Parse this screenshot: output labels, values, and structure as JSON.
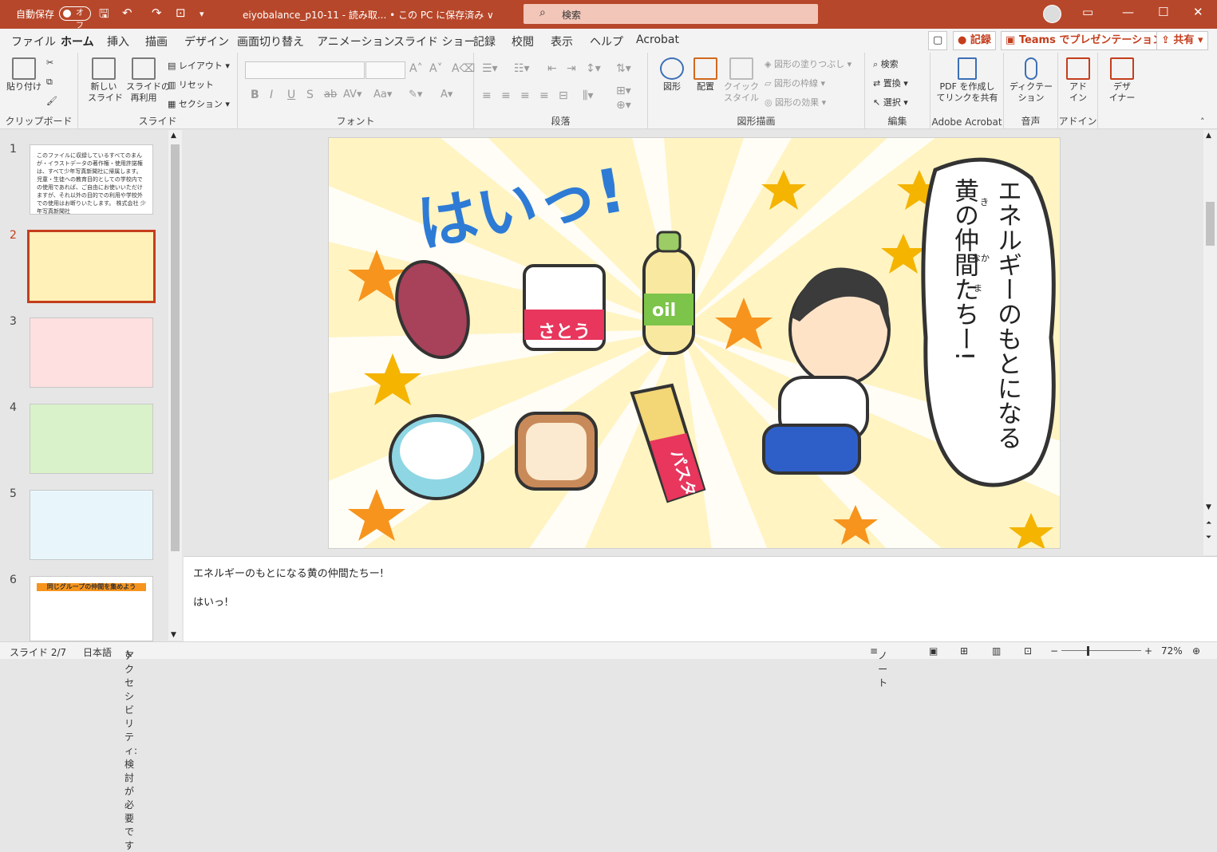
{
  "titlebar": {
    "autosave_label": "自動保存",
    "autosave_state": "オフ",
    "doc_title": "eiyobalance_p10-11 - 読み取... • この PC に保存済み ∨",
    "search_placeholder": "検索"
  },
  "tabs": [
    "ファイル",
    "ホーム",
    "挿入",
    "描画",
    "デザイン",
    "画面切り替え",
    "アニメーション",
    "スライド ショー",
    "記録",
    "校閲",
    "表示",
    "ヘルプ",
    "Acrobat"
  ],
  "tab_buttons": {
    "record": "記録",
    "teams": "Teams でプレゼンテーション",
    "share": "共有"
  },
  "ribbon": {
    "clipboard": {
      "paste": "貼り付け",
      "label": "クリップボード"
    },
    "slides": {
      "new_slide": "新しい\nスライド",
      "reuse": "スライドの\n再利用",
      "layout": "レイアウト",
      "reset": "リセット",
      "section": "セクション",
      "label": "スライド"
    },
    "font": {
      "label": "フォント",
      "bold": "B",
      "italic": "I",
      "underline": "U",
      "shadow": "S",
      "strike": "ab"
    },
    "paragraph": {
      "label": "段落"
    },
    "drawing": {
      "shapes": "図形",
      "arrange": "配置",
      "quick_styles": "クイック\nスタイル",
      "fill": "図形の塗りつぶし",
      "outline": "図形の枠線",
      "effects": "図形の効果",
      "label": "図形描画"
    },
    "editing": {
      "find": "検索",
      "replace": "置換",
      "select": "選択",
      "label": "編集"
    },
    "acrobat": {
      "pdf": "PDF を作成し\nてリンクを共有",
      "label": "Adobe Acrobat"
    },
    "voice": {
      "dictate": "ディクテー\nション",
      "label": "音声"
    },
    "addins": {
      "addins": "アド\nイン",
      "label": "アドイン"
    },
    "designer": {
      "designer": "デザ\nイナー"
    }
  },
  "thumbnails": [
    {
      "num": "1",
      "caption": "このファイルに収録しているすべてのまんが・イラストデータの著作権・使用許諾権は、すべて少年写真新聞社に帰属します。児童・生徒への教育目的としての学校内での使用であれば、ご自由にお使いいただけますが、それ以外の目的での利用や学校外での使用はお断りいたします。 株式会社 少年写真新聞社"
    },
    {
      "num": "2",
      "caption": ""
    },
    {
      "num": "3",
      "caption": ""
    },
    {
      "num": "4",
      "caption": ""
    },
    {
      "num": "5",
      "caption": ""
    },
    {
      "num": "6",
      "caption": "同じグループの仲間を集めよう"
    }
  ],
  "slide": {
    "shout": "はいっ!",
    "bubble_line1": "エネルギーのもとになる",
    "bubble_line2": "黄の仲間たちー!",
    "furigana_ki": "き",
    "furigana_naka": "なか",
    "furigana_ma": "ま",
    "label_sugar": "さとう",
    "label_oil": "oil",
    "label_pasta": "パスタ"
  },
  "notes": {
    "line1": "エネルギーのもとになる黄の仲間たちー!",
    "line2": "はいっ!"
  },
  "status": {
    "slide": "スライド 2/7",
    "lang": "日本語",
    "access": "アクセシビリティ: 検討が必要です",
    "notes_btn": "ノート",
    "zoom": "72%"
  },
  "colors": {
    "accent": "#b7472a",
    "slide_bg": "#fff5c6"
  }
}
